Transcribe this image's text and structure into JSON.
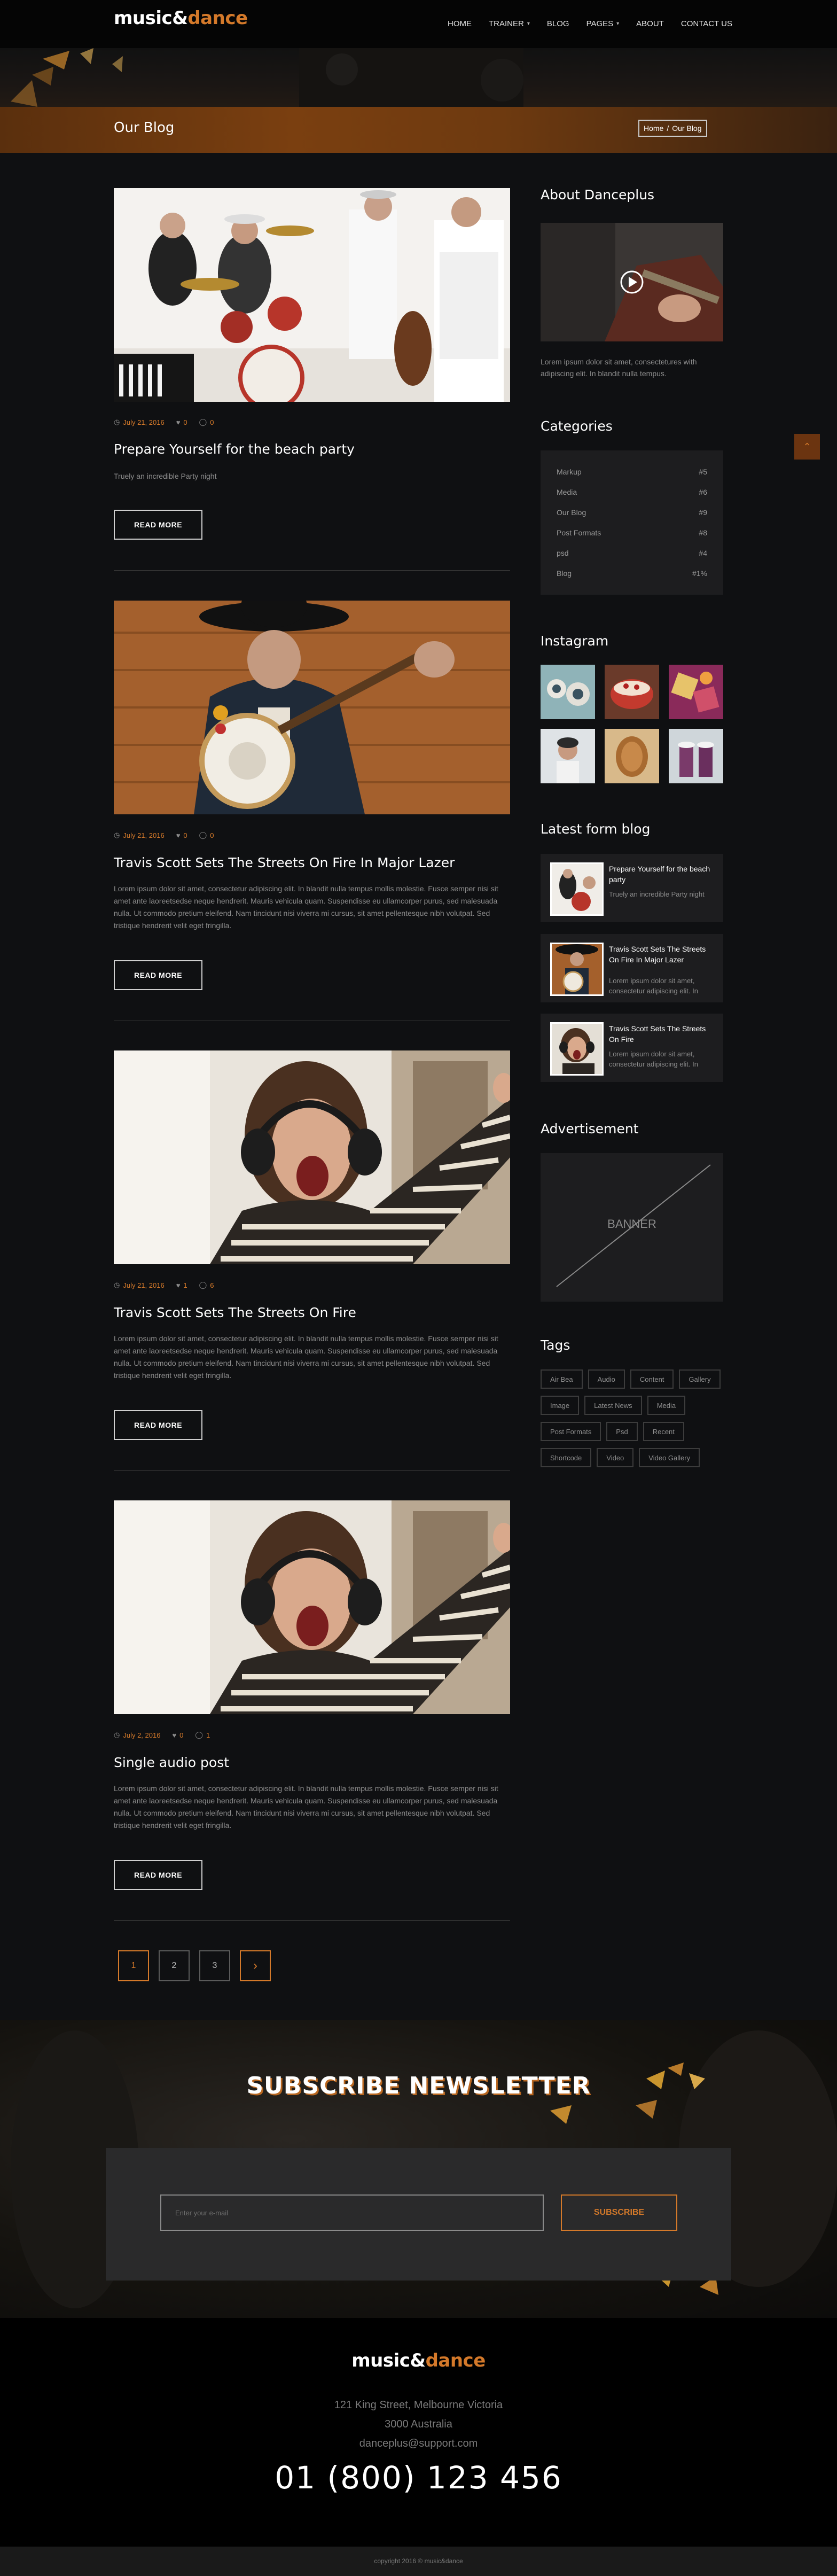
{
  "header": {
    "logo_main": "music",
    "logo_amp": "&",
    "logo_accent": "dance",
    "nav": [
      {
        "label": "HOME",
        "dropdown": false
      },
      {
        "label": "TRAINER",
        "dropdown": true
      },
      {
        "label": "BLOG",
        "dropdown": false
      },
      {
        "label": "PAGES",
        "dropdown": true
      },
      {
        "label": "ABOUT",
        "dropdown": false
      },
      {
        "label": "CONTACT US",
        "dropdown": false
      }
    ]
  },
  "page": {
    "title": "Our Blog",
    "breadcrumb": {
      "home": "Home",
      "sep": "/",
      "current": "Our Blog"
    }
  },
  "posts": [
    {
      "date": "July 21, 2016",
      "likes": "0",
      "comments": "0",
      "title": "Prepare Yourself for the beach party",
      "excerpt": "Truely an incredible Party night",
      "readmore": "READ MORE",
      "image": "band-photo"
    },
    {
      "date": "July 21, 2016",
      "likes": "0",
      "comments": "0",
      "title": "Travis Scott Sets The Streets On Fire In Major Lazer",
      "excerpt": "Lorem ipsum dolor sit amet, consectetur adipiscing elit. In blandit nulla tempus mollis molestie. Fusce semper nisi sit amet ante laoreetsedse neque hendrerit. Mauris vehicula quam.  Suspendisse eu ullamcorper purus, sed malesuada nulla. Ut commodo pretium eleifend. Nam tincidunt nisi viverra mi cursus, sit amet pellentesque nibh volutpat. Sed tristique hendrerit velit eget fringilla.",
      "readmore": "READ MORE",
      "image": "banjo-photo"
    },
    {
      "date": "July 21, 2016",
      "likes": "1",
      "comments": "6",
      "title": "Travis Scott Sets The Streets On Fire",
      "excerpt": "Lorem ipsum dolor sit amet, consectetur adipiscing elit. In blandit nulla tempus mollis molestie. Fusce semper nisi sit amet ante laoreetsedse neque hendrerit. Mauris vehicula quam.  Suspendisse eu ullamcorper purus, sed malesuada nulla. Ut commodo pretium eleifend. Nam tincidunt nisi viverra mi cursus, sit amet pellentesque nibh volutpat. Sed tristique hendrerit velit eget fringilla.",
      "readmore": "READ MORE",
      "image": "headphones-photo"
    },
    {
      "date": "July 2, 2016",
      "likes": "0",
      "comments": "1",
      "title": "Single audio post",
      "excerpt": "Lorem ipsum dolor sit amet, consectetur adipiscing elit. In blandit nulla tempus mollis molestie. Fusce semper nisi sit amet ante laoreetsedse neque hendrerit. Mauris vehicula quam.  Suspendisse eu ullamcorper purus, sed malesuada nulla. Ut commodo pretium eleifend. Nam tincidunt nisi viverra mi cursus, sit amet pellentesque nibh volutpat. Sed tristique hendrerit velit eget fringilla.",
      "readmore": "READ MORE",
      "image": "headphones-photo"
    }
  ],
  "pagination": {
    "pages": [
      "1",
      "2",
      "3"
    ],
    "next": "›",
    "current": "1"
  },
  "sidebar": {
    "about": {
      "heading": "About Danceplus",
      "text": "Lorem ipsum dolor sit amet, consectetures with adipiscing elit. In blandit nulla tempus."
    },
    "categories": {
      "heading": "Categories",
      "items": [
        {
          "name": "Markup",
          "count": "#5"
        },
        {
          "name": "Media",
          "count": "#6"
        },
        {
          "name": "Our Blog",
          "count": "#9"
        },
        {
          "name": "Post Formats",
          "count": "#8"
        },
        {
          "name": "psd",
          "count": "#4"
        },
        {
          "name": "Blog",
          "count": "#1%"
        }
      ]
    },
    "instagram": {
      "heading": "Instagram"
    },
    "latest": {
      "heading": "Latest form blog",
      "items": [
        {
          "title": "Prepare Yourself for the beach party",
          "text": "Truely an incredible Party night"
        },
        {
          "title": "Travis Scott Sets The Streets On Fire In Major Lazer",
          "text": "Lorem ipsum dolor sit amet, consectetur adipiscing elit. In"
        },
        {
          "title": "Travis Scott Sets The Streets On Fire",
          "text": "Lorem ipsum dolor sit amet, consectetur adipiscing elit. In"
        }
      ]
    },
    "advert": {
      "heading": "Advertisement",
      "banner": "BANNER"
    },
    "tags": {
      "heading": "Tags",
      "items": [
        "Air Bea",
        "Audio",
        "Content",
        "Gallery",
        "Image",
        "Latest News",
        "Media",
        "Post Formats",
        "Psd",
        "Recent",
        "Shortcode",
        "Video",
        "Video Gallery"
      ]
    }
  },
  "newsletter": {
    "title": "SUBSCRIBE NEWSLETTER",
    "placeholder": "Enter your e-mail",
    "button": "SUBSCRIBE"
  },
  "footer": {
    "logo_main": "music",
    "logo_amp": "&",
    "logo_accent": "dance",
    "address1": "121 King Street, Melbourne Victoria",
    "address2": "3000 Australia",
    "email": "danceplus@support.com",
    "phone": "01 (800) 123 456",
    "copyright": "copyright 2016 © music&dance"
  },
  "colors": {
    "accent": "#d4792a",
    "bg": "#0f1012",
    "panel": "#1d1d1f"
  }
}
